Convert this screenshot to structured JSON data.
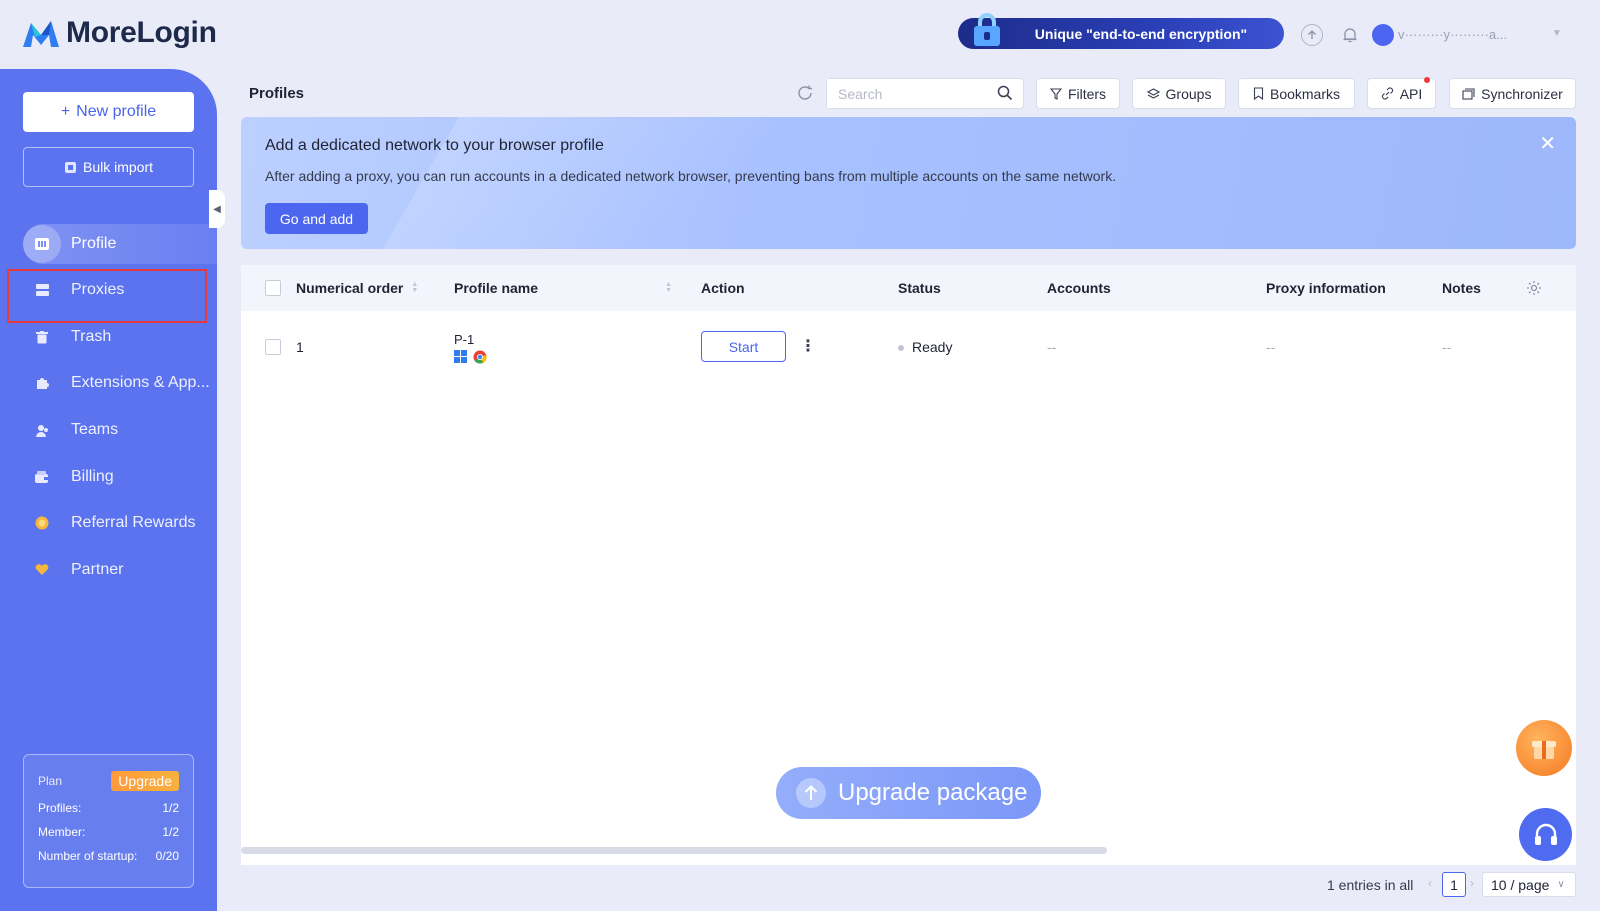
{
  "app": {
    "name": "MoreLogin"
  },
  "promo": {
    "text": "Unique \"end-to-end encryption\""
  },
  "user": {
    "name": "v·········y·········a..."
  },
  "sidebar": {
    "new_profile": "New profile",
    "bulk_import": "Bulk import",
    "items": [
      {
        "label": "Profile",
        "icon": "profile-icon"
      },
      {
        "label": "Proxies",
        "icon": "proxies-icon"
      },
      {
        "label": "Trash",
        "icon": "trash-icon"
      },
      {
        "label": "Extensions & App...",
        "icon": "extensions-icon"
      },
      {
        "label": "Teams",
        "icon": "teams-icon"
      },
      {
        "label": "Billing",
        "icon": "billing-icon"
      },
      {
        "label": "Referral Rewards",
        "icon": "referral-icon"
      },
      {
        "label": "Partner",
        "icon": "partner-icon"
      }
    ],
    "plan": {
      "label": "Plan",
      "upgrade": "Upgrade",
      "rows": [
        {
          "label": "Profiles:",
          "value": "1/2"
        },
        {
          "label": "Member:",
          "value": "1/2"
        },
        {
          "label": "Number of startup:",
          "value": "0/20"
        }
      ]
    }
  },
  "main": {
    "title": "Profiles",
    "search_placeholder": "Search",
    "toolbar": {
      "filters": "Filters",
      "groups": "Groups",
      "bookmarks": "Bookmarks",
      "api": "API",
      "synchronizer": "Synchronizer"
    },
    "banner": {
      "title": "Add a dedicated network to your browser profile",
      "description": "After adding a proxy, you can run accounts in a dedicated network browser, preventing bans from multiple accounts on the same network.",
      "button": "Go and add"
    },
    "table": {
      "columns": [
        "Numerical order",
        "Profile name",
        "Action",
        "Status",
        "Accounts",
        "Proxy information",
        "Notes"
      ],
      "rows": [
        {
          "order": "1",
          "name": "P-1",
          "action": "Start",
          "status": "Ready",
          "accounts": "--",
          "proxy": "--",
          "notes": "--"
        }
      ]
    },
    "upgrade_package": "Upgrade package",
    "pagination": {
      "total": "1 entries in all",
      "page": "1",
      "per_page": "10 / page"
    }
  },
  "colors": {
    "accent": "#4c66ef",
    "sidebar": "#5b73ee",
    "highlight": "#e33b3b"
  }
}
